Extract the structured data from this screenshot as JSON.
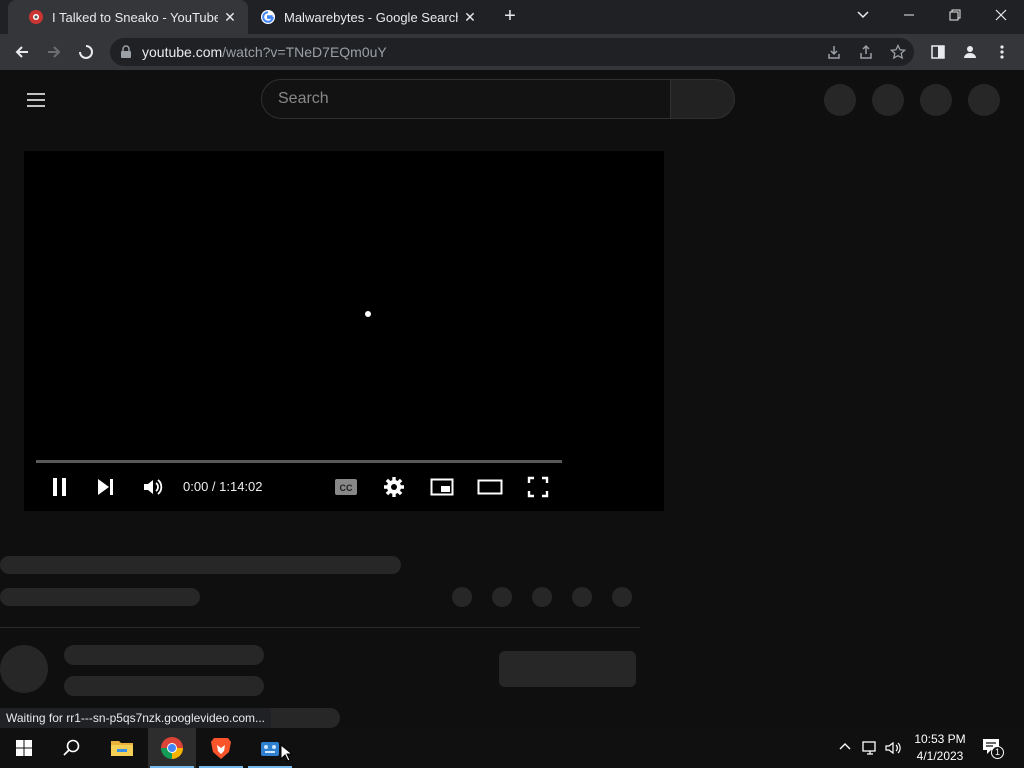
{
  "browser": {
    "tabs": [
      {
        "title": "I Talked to Sneako - YouTube",
        "active": true,
        "favicon": "youtube-favicon"
      },
      {
        "title": "Malwarebytes - Google Search",
        "active": false,
        "favicon": "google-favicon"
      }
    ],
    "url_host": "youtube.com",
    "url_rest": "/watch?v=TNeD7EQm0uY"
  },
  "youtube": {
    "search_placeholder": "Search"
  },
  "player": {
    "time": "0:00 / 1:14:02",
    "progress": 0
  },
  "status_bar": "Waiting for rr1---sn-p5qs7nzk.googlevideo.com...",
  "taskbar": {
    "time": "10:53 PM",
    "date": "4/1/2023",
    "notification_count": "1",
    "apps": [
      "windows-start-icon",
      "search-icon",
      "file-explorer-icon",
      "chrome-icon",
      "brave-icon",
      "app-icon"
    ]
  },
  "colors": {
    "page_bg": "#0f0f0f",
    "skeleton": "#272727",
    "chrome_dark": "#202124",
    "chrome_toolbar": "#35363a",
    "taskbar_accent": "#76b9ed"
  }
}
